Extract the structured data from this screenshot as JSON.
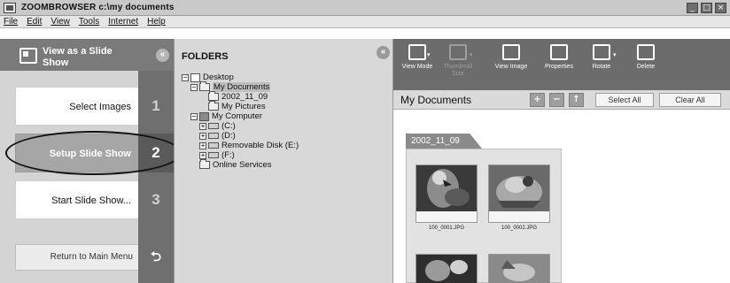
{
  "window": {
    "title": "ZOOMBROWSER c:\\my documents",
    "controls": [
      "minimize",
      "maximize",
      "close"
    ]
  },
  "menubar": [
    "File",
    "Edit",
    "View",
    "Tools",
    "Internet",
    "Help"
  ],
  "left_panel": {
    "title": "View as a Slide Show",
    "collapse_glyph": "«",
    "steps": [
      {
        "label": "Select Images",
        "number": "1",
        "active": false
      },
      {
        "label": "Setup Slide Show",
        "number": "2",
        "active": true
      },
      {
        "label": "Start Slide Show...",
        "number": "3",
        "active": false
      }
    ],
    "return_label": "Return to Main Menu",
    "return_glyph": "⮌"
  },
  "folders_panel": {
    "title": "FOLDERS",
    "collapse_glyph": "«",
    "tree": [
      {
        "label": "Desktop",
        "level": 0,
        "expander": "−",
        "icon": "desktop-icon"
      },
      {
        "label": "My Documents",
        "level": 1,
        "expander": "−",
        "icon": "folder-open-icon",
        "selected": true
      },
      {
        "label": "2002_11_09",
        "level": 2,
        "expander": "",
        "icon": "folder-icon"
      },
      {
        "label": "My Pictures",
        "level": 2,
        "expander": "",
        "icon": "folder-icon"
      },
      {
        "label": "My Computer",
        "level": 1,
        "expander": "−",
        "icon": "computer-icon"
      },
      {
        "label": "(C:)",
        "level": 2,
        "expander": "+",
        "icon": "drive-icon"
      },
      {
        "label": "(D:)",
        "level": 2,
        "expander": "+",
        "icon": "drive-icon"
      },
      {
        "label": "Removable Disk (E:)",
        "level": 2,
        "expander": "+",
        "icon": "drive-icon"
      },
      {
        "label": "(F:)",
        "level": 2,
        "expander": "+",
        "icon": "drive-icon"
      },
      {
        "label": "Online Services",
        "level": 1,
        "expander": "",
        "icon": "folder-icon"
      }
    ]
  },
  "toolbar": {
    "buttons": [
      {
        "label": "View Mode",
        "icon": "view-mode-icon",
        "enabled": true
      },
      {
        "label": "Thumbnail Size",
        "icon": "thumbnail-size-icon",
        "enabled": false
      },
      {
        "label": "View Image",
        "icon": "view-image-icon",
        "enabled": true
      },
      {
        "label": "Properties",
        "icon": "properties-icon",
        "enabled": true
      },
      {
        "label": "Rotate",
        "icon": "rotate-icon",
        "enabled": true
      },
      {
        "label": "Delete",
        "icon": "delete-icon",
        "enabled": true
      }
    ]
  },
  "content": {
    "breadcrumb": "My Documents",
    "zoom_in_glyph": "+",
    "zoom_out_glyph": "−",
    "up_glyph": "↑",
    "select_all_label": "Select All",
    "clear_all_label": "Clear All",
    "folder_tab_label": "2002_11_09",
    "thumbnails": [
      {
        "name": "100_0001.JPG",
        "subject": "parrot"
      },
      {
        "name": "100_0002.JPG",
        "subject": "bird"
      },
      {
        "name": "",
        "subject": "animal"
      },
      {
        "name": "",
        "subject": "animal"
      }
    ]
  }
}
